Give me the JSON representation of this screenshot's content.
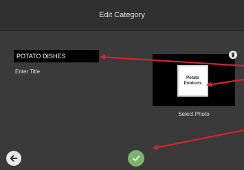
{
  "header": {
    "title": "Edit Category"
  },
  "form": {
    "title_value": "POTATO DISHES",
    "title_label": "Enter Title",
    "photo_label": "Select Photo",
    "photo_tile_line1": "Potato",
    "photo_tile_line2": "Products"
  },
  "icons": {
    "delete": "trash-icon",
    "back": "arrow-left-icon",
    "confirm": "checkmark-icon"
  },
  "colors": {
    "confirm_green": "#7db36a",
    "annotation_red": "#d8232f"
  }
}
